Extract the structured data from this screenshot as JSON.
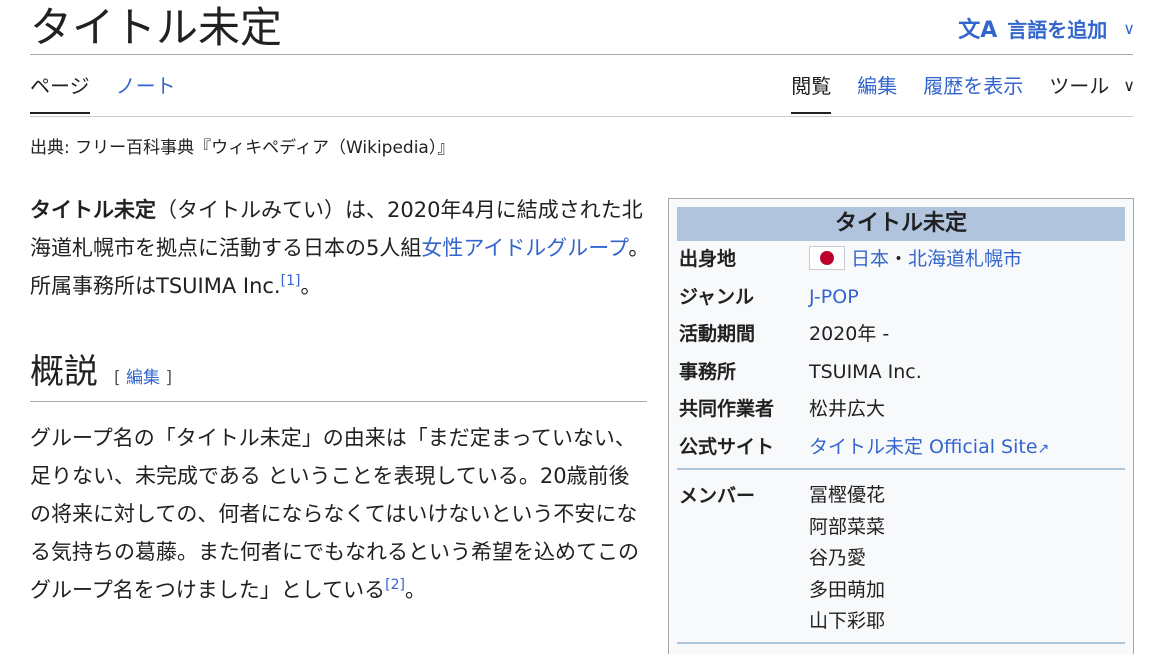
{
  "page": {
    "title": "タイトル未定",
    "add_languages": "言語を追加",
    "lang_icon": "文A"
  },
  "tabs": {
    "page": "ページ",
    "talk": "ノート",
    "read": "閲覧",
    "edit": "編集",
    "history": "履歴を表示",
    "tools": "ツール"
  },
  "source": "出典: フリー百科事典『ウィキペディア（Wikipedia）』",
  "lead": {
    "bold": "タイトル未定",
    "text1": "（タイトルみてい）は、2020年4月に結成された北海道札幌市を拠点に活動する日本の5人組",
    "link": "女性アイドルグループ",
    "text2": "。所属事務所はTSUIMA Inc.",
    "ref": "[1]",
    "end": "。"
  },
  "section": {
    "heading": "概説",
    "edit_open": "[ ",
    "edit_label": "編集",
    "edit_close": " ]",
    "paragraph": "グループ名の「タイトル未定」の由来は「まだ定まっていない、足りない、未完成である ということを表現している。20歳前後の将来に対しての、何者にならなくてはいけないという不安になる気持ちの葛藤。また何者にでもなれるという希望を込めてこのグループ名をつけました」としている",
    "ref": "[2]",
    "end": "。"
  },
  "infobox": {
    "title": "タイトル未定",
    "origin_label": "出身地",
    "origin_country": "日本",
    "origin_sep": "・",
    "origin_city": "北海道札幌市",
    "genre_label": "ジャンル",
    "genre": "J-POP",
    "active_label": "活動期間",
    "active": "2020年 -",
    "agency_label": "事務所",
    "agency": "TSUIMA Inc.",
    "collab_label": "共同作業者",
    "collab": "松井広大",
    "site_label": "公式サイト",
    "site": "タイトル未定 Official Site",
    "members_label": "メンバー",
    "members": [
      "冨樫優花",
      "阿部菜菜",
      "谷乃愛",
      "多田萌加",
      "山下彩耶"
    ],
    "flag_color": "#bc002d",
    "header_color": "#b0c4de"
  }
}
